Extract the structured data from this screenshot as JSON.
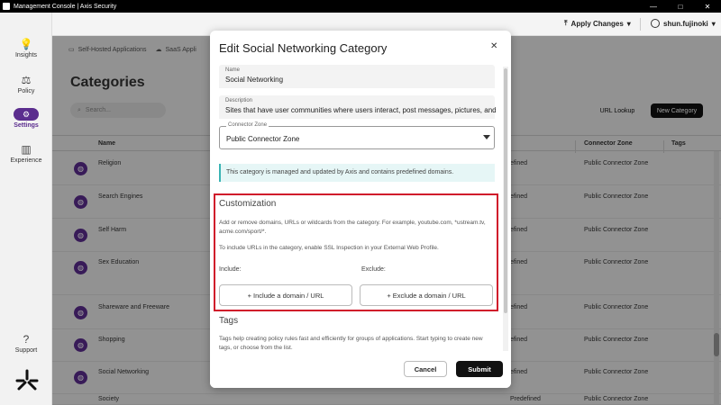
{
  "window": {
    "title": "Management Console | Axis Security",
    "controls": [
      "—",
      "□",
      "✕"
    ]
  },
  "sidebar": {
    "items": [
      {
        "label": "Insights",
        "icon": "lightbulb-icon"
      },
      {
        "label": "Policy",
        "icon": "policy-icon"
      },
      {
        "label": "Settings",
        "icon": "gear-icon"
      },
      {
        "label": "Experience",
        "icon": "bar-chart-icon"
      },
      {
        "label": "Support",
        "icon": "help-icon"
      }
    ]
  },
  "header": {
    "apply_changes": "Apply Changes",
    "user": "shun.fujinoki"
  },
  "main": {
    "tabs": [
      "Self-Hosted Applications",
      "SaaS Appli"
    ],
    "title": "Categories",
    "search_placeholder": "Search...",
    "url_lookup": "URL Lookup",
    "new_category": "New Category",
    "columns": {
      "name": "Name",
      "connector_zone": "Connector Zone",
      "tags": "Tags"
    },
    "rows": [
      {
        "name": "Religion",
        "type": "efined",
        "zone": "Public Connector Zone"
      },
      {
        "name": "Search Engines",
        "type": "efined",
        "zone": "Public Connector Zone"
      },
      {
        "name": "Self Harm",
        "type": "efined",
        "zone": "Public Connector Zone"
      },
      {
        "name": "Sex Education",
        "type": "efined",
        "zone": "Public Connector Zone"
      },
      {
        "name": "Shareware and Freeware",
        "type": "efined",
        "zone": "Public Connector Zone"
      },
      {
        "name": "Shopping",
        "type": "efined",
        "zone": "Public Connector Zone"
      },
      {
        "name": "Social Networking",
        "type": "efined",
        "zone": "Public Connector Zone"
      },
      {
        "name": "Society",
        "type": "Predefined",
        "zone": "Public Connector Zone"
      }
    ]
  },
  "modal": {
    "title": "Edit Social Networking Category",
    "name_label": "Name",
    "name_value": "Social Networking",
    "description_label": "Description",
    "description_value": "Sites that have user communities where users interact, post messages, pictures, and",
    "zone_label": "Connector Zone",
    "zone_value": "Public Connector Zone",
    "info_text": "This category is managed and updated by Axis and contains predefined domains.",
    "customization": {
      "title": "Customization",
      "text1": "Add or remove domains, URLs or wildcards from the category. For example, youtube.com, *ustream.tv, acme.com/sport/*.",
      "text2": "To include URLs in the category, enable SSL Inspection in your External Web Profile.",
      "include_label": "Include:",
      "exclude_label": "Exclude:",
      "include_button": "+ Include a domain / URL",
      "exclude_button": "+ Exclude a domain / URL"
    },
    "tags_title": "Tags",
    "tags_text": "Tags help creating policy rules fast and efficiently for groups of applications. Start typing to create new tags, or choose from the list.",
    "cancel": "Cancel",
    "submit": "Submit"
  }
}
